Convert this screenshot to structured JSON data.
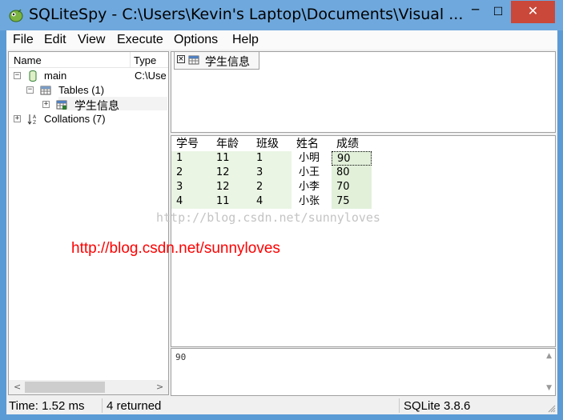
{
  "window": {
    "title": "SQLiteSpy - C:\\Users\\Kevin's Laptop\\Documents\\Visual ...",
    "minimize": "─",
    "maximize": "☐",
    "close": "✕"
  },
  "menu": {
    "items": [
      "File",
      "Edit",
      "View",
      "Execute",
      "Options",
      "Help"
    ]
  },
  "tree": {
    "headers": {
      "name": "Name",
      "type": "Type"
    },
    "nodes": {
      "main": {
        "label": "main",
        "type": "C:\\Use",
        "expander": "−"
      },
      "tables": {
        "label": "Tables (1)",
        "expander": "−"
      },
      "student_table": {
        "label": "学生信息",
        "expander": "+"
      },
      "collations": {
        "label": "Collations (7)",
        "expander": "+"
      }
    },
    "scroll_left": "<",
    "scroll_right": ">"
  },
  "tab": {
    "close": "×",
    "label": "学生信息"
  },
  "grid": {
    "columns": [
      "学号",
      "年龄",
      "班级",
      "姓名",
      "成绩"
    ],
    "rows": [
      [
        "1",
        "11",
        "1",
        "小明",
        "90"
      ],
      [
        "2",
        "12",
        "3",
        "小王",
        "80"
      ],
      [
        "3",
        "12",
        "2",
        "小李",
        "70"
      ],
      [
        "4",
        "11",
        "4",
        "小张",
        "75"
      ]
    ]
  },
  "watermark": {
    "gray": "http://blog.csdn.net/sunnyloves",
    "red": "http://blog.csdn.net/sunnyloves"
  },
  "detail": {
    "value": "90",
    "scroll_up": "▲",
    "scroll_down": "▼"
  },
  "status": {
    "time": "Time: 1.52 ms",
    "returned": "4 returned",
    "version": "SQLite 3.8.6"
  },
  "colors": {
    "titlebar": "#6fa8dc",
    "close_button": "#c9483a",
    "cell_green": "#eaf5e4",
    "watermark_red": "#ff0000"
  }
}
